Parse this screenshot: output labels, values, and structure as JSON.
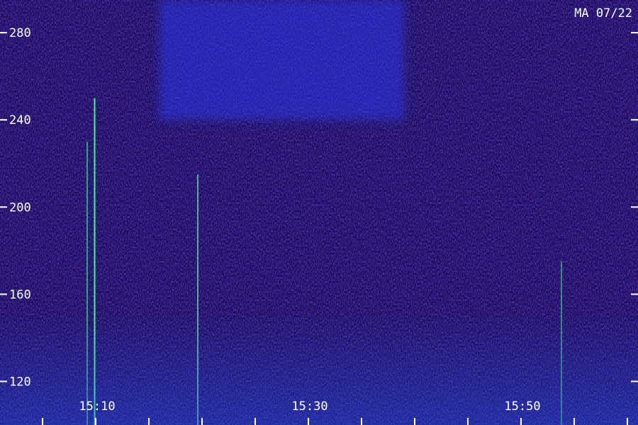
{
  "chart_data": {
    "type": "heatmap",
    "title": "MA 07/22",
    "xlabel": "",
    "ylabel": "",
    "y_ticks": [
      120,
      160,
      200,
      240,
      280
    ],
    "y_tick_labels": [
      "120",
      "160",
      "200",
      "240",
      "280"
    ],
    "ylim": [
      100,
      295
    ],
    "x_tick_labels": [
      "15:10",
      "15:30",
      "15:50"
    ],
    "x_tick_values_min": [
      910,
      930,
      950
    ],
    "xlim_min": [
      901,
      961
    ],
    "grid": false,
    "colormap": [
      "#050018",
      "#1a0a6e",
      "#2a1ad8",
      "#1f5cff",
      "#10c8e8",
      "#5cff70"
    ],
    "features": [
      {
        "kind": "vertical_line",
        "time_min": 909.9,
        "y_from": 100,
        "y_to": 250,
        "intensity": 0.95
      },
      {
        "kind": "vertical_line",
        "time_min": 909.2,
        "y_from": 100,
        "y_to": 230,
        "intensity": 0.55
      },
      {
        "kind": "vertical_line",
        "time_min": 919.6,
        "y_from": 100,
        "y_to": 215,
        "intensity": 0.7
      },
      {
        "kind": "vertical_line",
        "time_min": 953.8,
        "y_from": 100,
        "y_to": 175,
        "intensity": 0.5
      },
      {
        "kind": "bright_region",
        "time_from": 916,
        "time_to": 939,
        "y_from": 240,
        "y_to": 295,
        "intensity": 0.45
      },
      {
        "kind": "low_band",
        "y_from": 100,
        "y_to": 150,
        "intensity": 0.5
      }
    ]
  }
}
